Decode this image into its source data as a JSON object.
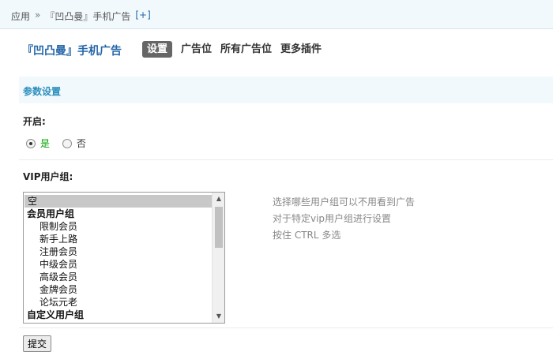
{
  "breadcrumb": {
    "root": "应用",
    "separator": "»",
    "current": "『凹凸曼』手机广告",
    "add": "[+]"
  },
  "plugin": {
    "title": "『凹凸曼』手机广告",
    "tabs": [
      {
        "label": "设置",
        "active": true
      },
      {
        "label": "广告位",
        "active": false
      },
      {
        "label": "所有广告位",
        "active": false
      },
      {
        "label": "更多插件",
        "active": false
      }
    ]
  },
  "section": {
    "title": "参数设置"
  },
  "enable": {
    "label": "开启:",
    "options": [
      {
        "label": "是",
        "checked": true
      },
      {
        "label": "否",
        "checked": false
      }
    ]
  },
  "vip": {
    "label": "VIP用户组:",
    "options": [
      {
        "label": "空",
        "kind": "option",
        "selected": true
      },
      {
        "label": "会员用户组",
        "kind": "group",
        "selected": false
      },
      {
        "label": "限制会员",
        "kind": "child",
        "selected": false
      },
      {
        "label": "新手上路",
        "kind": "child",
        "selected": false
      },
      {
        "label": "注册会员",
        "kind": "child",
        "selected": false
      },
      {
        "label": "中级会员",
        "kind": "child",
        "selected": false
      },
      {
        "label": "高级会员",
        "kind": "child",
        "selected": false
      },
      {
        "label": "金牌会员",
        "kind": "child",
        "selected": false
      },
      {
        "label": "论坛元老",
        "kind": "child",
        "selected": false
      },
      {
        "label": "自定义用户组",
        "kind": "group",
        "selected": false
      }
    ],
    "hints": [
      "选择哪些用户组可以不用看到广告",
      "对于特定vip用户组进行设置",
      "按住 CTRL 多选"
    ]
  },
  "submit": {
    "label": "提交"
  },
  "colors": {
    "accent": "#2366a8",
    "section_title": "#2b8fbd",
    "header_bg": "#f2f9fd",
    "yes_green": "#00a000"
  }
}
